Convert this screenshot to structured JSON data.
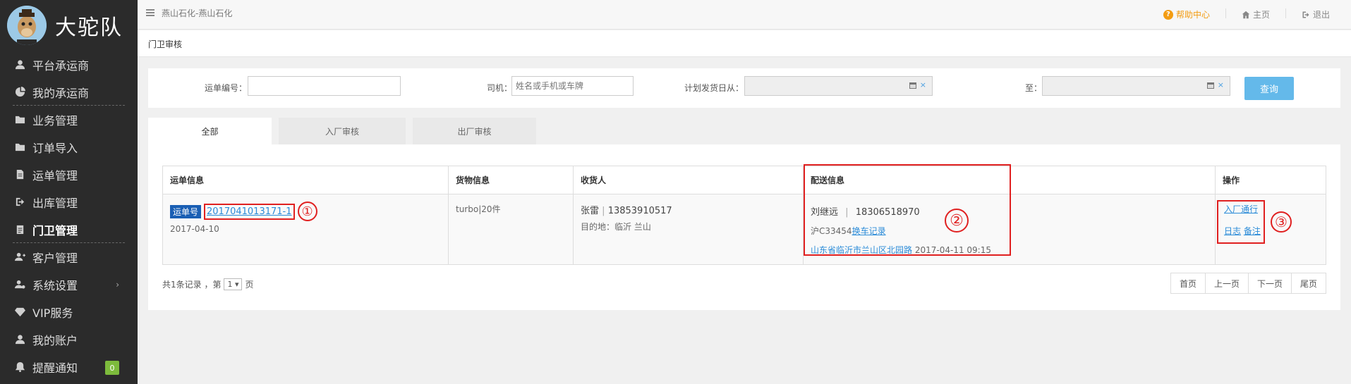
{
  "brand": {
    "name": "大驼队"
  },
  "sidebar": {
    "items": [
      {
        "label": "平台承运商",
        "icon": "user-icon"
      },
      {
        "label": "我的承运商",
        "icon": "pie-chart-icon"
      },
      {
        "label": "业务管理",
        "icon": "folder-icon"
      },
      {
        "label": "订单导入",
        "icon": "folder-icon"
      },
      {
        "label": "运单管理",
        "icon": "document-icon"
      },
      {
        "label": "出库管理",
        "icon": "sign-out-icon"
      },
      {
        "label": "门卫管理",
        "icon": "clipboard-icon"
      },
      {
        "label": "客户管理",
        "icon": "add-user-icon"
      },
      {
        "label": "系统设置",
        "icon": "user-settings-icon"
      },
      {
        "label": "VIP服务",
        "icon": "diamond-icon"
      },
      {
        "label": "我的账户",
        "icon": "user-circle-icon"
      },
      {
        "label": "提醒通知",
        "icon": "bell-icon",
        "badge": "0"
      }
    ]
  },
  "topbar": {
    "breadcrumb": "燕山石化-燕山石化",
    "help": "帮助中心",
    "home": "主页",
    "logout": "退出"
  },
  "page": {
    "title": "门卫审核"
  },
  "filter": {
    "waybill_label": "运单编号：",
    "waybill_value": "",
    "driver_label": "司机：",
    "driver_placeholder": "姓名或手机或车牌",
    "date_from_label": "计划发货日从：",
    "date_to_label": "至：",
    "query_button": "查询"
  },
  "tabs": [
    {
      "label": "全部",
      "active": true
    },
    {
      "label": "入厂审核",
      "active": false
    },
    {
      "label": "出厂审核",
      "active": false
    }
  ],
  "table": {
    "headers": [
      "运单信息",
      "货物信息",
      "收货人",
      "配送信息",
      "操作"
    ],
    "rows": [
      {
        "tag": "运单号",
        "waybill_no": "2017041013171-1",
        "date": "2017-04-10",
        "goods": "turbo|20件",
        "receiver_name": "张雷",
        "receiver_sep": "|",
        "receiver_phone": "13853910517",
        "destination": "目的地：临沂 兰山",
        "driver_name": "刘继远",
        "driver_sep": "|",
        "driver_phone": "18306518970",
        "plate": "沪C33454",
        "change_vehicle_link": "换车记录",
        "location": "山东省临沂市兰山区北园路",
        "location_time": "2017-04-11 09:15",
        "action_enter": "入厂通行",
        "action_log": "日志",
        "action_note": "备注",
        "marker1": "①",
        "marker2": "②",
        "marker3": "③"
      }
    ]
  },
  "footer": {
    "total_text": "共1条记录 ，第",
    "page_value": "1",
    "page_unit": "页"
  },
  "pager": {
    "first": "首页",
    "prev": "上一页",
    "next": "下一页",
    "last": "尾页"
  }
}
